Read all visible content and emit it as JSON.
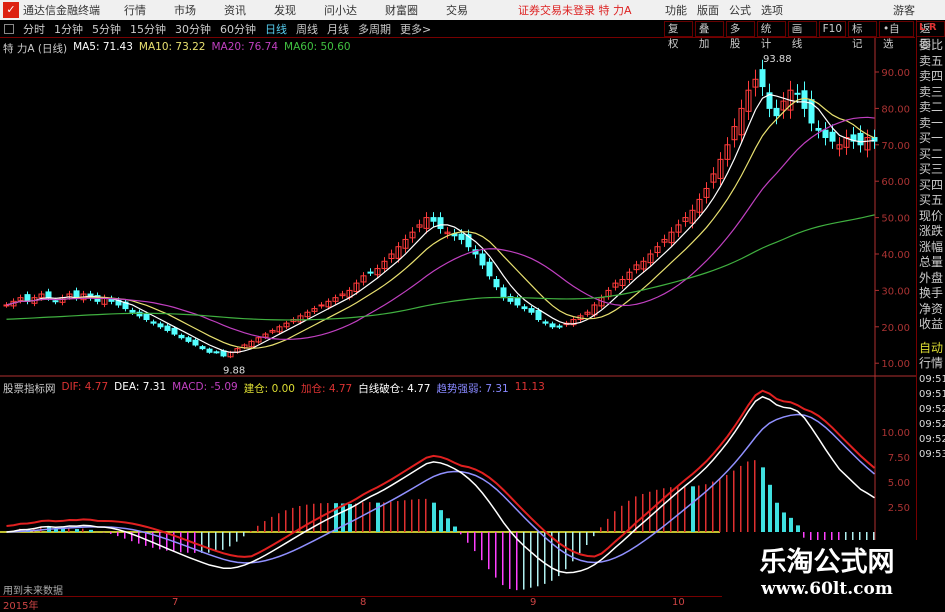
{
  "app": {
    "title": "通达信金融终端",
    "menu": [
      "行情",
      "市场",
      "资讯",
      "发现",
      "问小达",
      "财富圈",
      "交易"
    ],
    "warning": "证券交易未登录  特 力A",
    "right_menu": [
      "功能",
      "版面",
      "公式",
      "选项"
    ],
    "guest": "游客"
  },
  "periods": {
    "items": [
      "分时",
      "1分钟",
      "5分钟",
      "15分钟",
      "30分钟",
      "60分钟",
      "日线",
      "周线",
      "月线",
      "多周期",
      "更多>"
    ],
    "active": "日线"
  },
  "tools": [
    "复权",
    "叠加",
    "多股",
    "统计",
    "画线",
    "F10",
    "标记",
    "•自选",
    "返回"
  ],
  "ma_info": {
    "name": "特 力A (日线)",
    "ma5": "MA5: 71.43",
    "ma10": "MA10: 73.22",
    "ma20": "MA20: 76.74",
    "ma60": "MA60: 50.60"
  },
  "macd_info": {
    "name": "股票指标网",
    "dif": "DIF: 4.77",
    "dea": "DEA: 7.31",
    "macd": "MACD: -5.09",
    "jiancang": "建仓: 0.00",
    "jiacang": "加仓: 4.77",
    "baixian": "白线破仓: 4.77",
    "qushi": "趋势强弱: 7.31",
    "last": "11.13"
  },
  "side": {
    "lr": "L R",
    "items": [
      "委比",
      "卖五",
      "卖四",
      "卖三",
      "卖二",
      "卖一",
      "买一",
      "买二",
      "买三",
      "买四",
      "买五",
      "现价",
      "涨跌",
      "涨幅",
      "总量",
      "外盘",
      "换手",
      "净资",
      "收益"
    ],
    "auto": "自动",
    "hq": "行情",
    "times": [
      "09:51",
      "09:51",
      "09:52",
      "09:52",
      "09:52",
      "09:53"
    ]
  },
  "bottom": {
    "labels": [
      "2015年",
      "7",
      "8",
      "9",
      "10"
    ],
    "note": "用到未来数据"
  },
  "watermark": {
    "cn": "乐淘公式网",
    "url": "www.60lt.com"
  },
  "colors": {
    "up": "#ff3c3c",
    "down": "#54ffff",
    "ma5": "#ffffff",
    "ma10": "#e8e070",
    "ma20": "#c040c0",
    "ma60": "#40b040",
    "dif": "#ffffff",
    "dea": "#9090ff",
    "axis": "#b03030"
  },
  "chart_data": [
    {
      "type": "candlestick",
      "title": "特 力A (日线)",
      "ylim": [
        5,
        97
      ],
      "yticks": [
        10,
        20,
        30,
        40,
        50,
        60,
        70,
        80,
        90
      ],
      "annotations": [
        {
          "text": "93.88",
          "value": 93.88
        },
        {
          "text": "9.88",
          "value": 9.88
        }
      ],
      "close": [
        26,
        27,
        28,
        27,
        28,
        29,
        28,
        27,
        28,
        29,
        28,
        29,
        28,
        27,
        28,
        27,
        26,
        25,
        24,
        23,
        22,
        21,
        20,
        19,
        18,
        17,
        16,
        15,
        14,
        13,
        13,
        12,
        13,
        14,
        15,
        16,
        17,
        18,
        19,
        20,
        21,
        22,
        23,
        24,
        25,
        26,
        27,
        28,
        29,
        30,
        32,
        34,
        35,
        36,
        38,
        40,
        42,
        44,
        46,
        48,
        50,
        49,
        47,
        46,
        45,
        44,
        42,
        40,
        37,
        34,
        31,
        28,
        27,
        26,
        25,
        24,
        22,
        21,
        20,
        20,
        21,
        22,
        23,
        24,
        26,
        28,
        30,
        32,
        33,
        35,
        37,
        38,
        40,
        42,
        44,
        46,
        48,
        50,
        52,
        55,
        58,
        62,
        66,
        70,
        75,
        80,
        85,
        88,
        86,
        80,
        78,
        82,
        85,
        84,
        80,
        76,
        74,
        72,
        71,
        70,
        72,
        71,
        70,
        72,
        71
      ]
    },
    {
      "type": "line",
      "title": "MACD",
      "yticks": [
        2.5,
        5,
        7.5,
        10
      ],
      "series": [
        {
          "name": "DIF"
        },
        {
          "name": "DEA"
        },
        {
          "name": "MACD"
        }
      ]
    }
  ]
}
